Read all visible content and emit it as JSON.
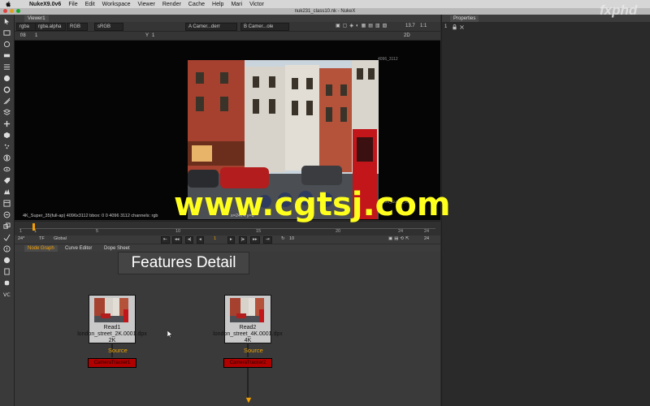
{
  "menubar": {
    "app_name": "NukeX9.0v6",
    "items": [
      "File",
      "Edit",
      "Workspace",
      "Viewer",
      "Render",
      "Cache",
      "Help",
      "Mari",
      "Victor"
    ]
  },
  "window": {
    "title": "nuk231_class10.nk - NukeX"
  },
  "viewer": {
    "tab": "Viewer1",
    "channels": "rgba",
    "layer": "rgba.alpha",
    "display": "RGB",
    "colorspace": "sRGB",
    "input_a": "Camer...derr",
    "input_b": "Camer...ole",
    "zoom": "13.7",
    "ratio": "1:1",
    "view_mode": "2D",
    "fstop": "f/8",
    "gain": "1",
    "y_label": "Y",
    "gamma": "1",
    "format_label": "4096_3112",
    "format_label_2": "4096_Super_35",
    "info_text": "4K_Super_35(full-ap) 4096x3112  bbox: 0 0 4096 3112 channels: rgb",
    "coord_text": "x=2474 y=0"
  },
  "timeline": {
    "ticks": [
      "1",
      "5",
      "10",
      "15",
      "20",
      "24"
    ],
    "start": "1",
    "end": "24",
    "fps": "24*",
    "tf": "TF",
    "scope": "Global",
    "current_frame": "1",
    "step": "10",
    "end_frame_box": "24"
  },
  "nodegraph": {
    "tabs": [
      "Node Graph",
      "Curve Editor",
      "Dope Sheet"
    ],
    "backdrop_label": "Features Detail",
    "nodes": [
      {
        "name": "Read1",
        "file": "london_street_2K.0001.dpx",
        "res": "2K",
        "source": "Source",
        "tracker": "CameraTracker1"
      },
      {
        "name": "Read2",
        "file": "london_street_4K.0001.dpx",
        "res": "4K",
        "source": "Source",
        "tracker": "CameraTracker2"
      }
    ]
  },
  "properties": {
    "tab": "Properties",
    "count": "1"
  },
  "watermarks": {
    "site": "www.cgtsj.com",
    "brand": "fxphd"
  },
  "colors": {
    "tracker_red": "#b00000",
    "source_orange": "#f0a500",
    "watermark_yellow": "#ffff1e"
  }
}
